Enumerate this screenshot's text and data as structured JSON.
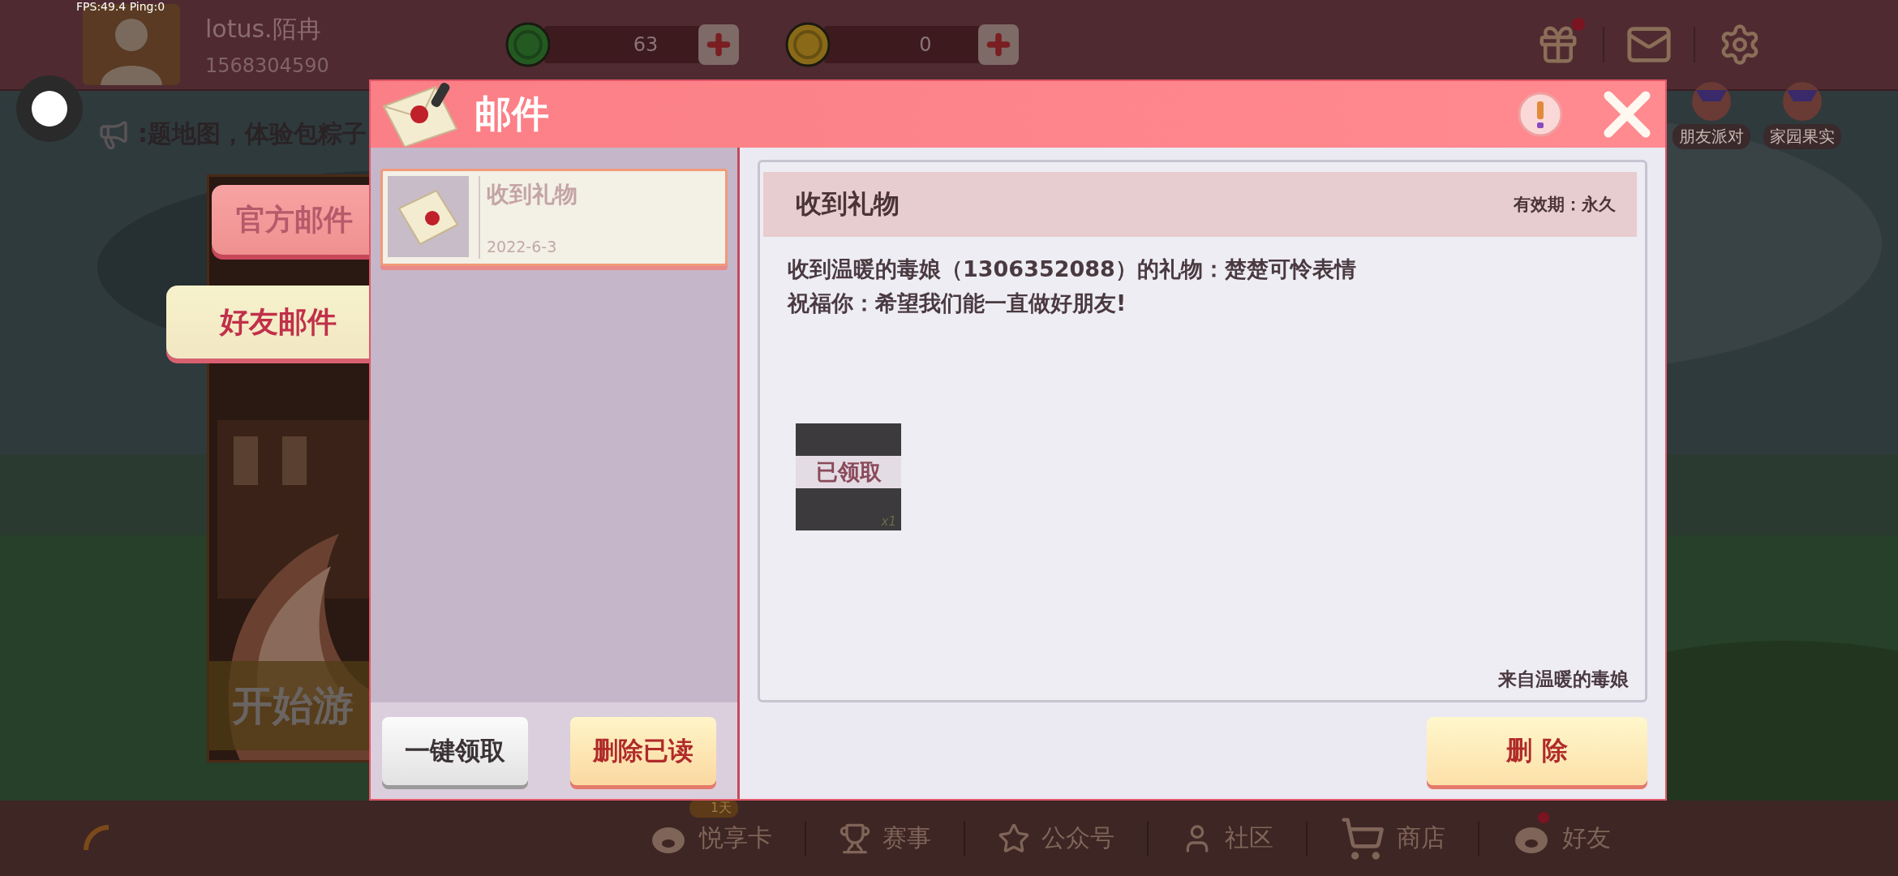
{
  "fps_overlay": "FPS:49.4  Ping:0",
  "profile": {
    "name": "lotus.陌冉",
    "id": "1568304590"
  },
  "currencies": [
    {
      "kind": "green",
      "amount": "63"
    },
    {
      "kind": "gold",
      "amount": "0"
    }
  ],
  "top_icons": [
    {
      "kind": "gift",
      "badge": true
    },
    {
      "kind": "mail",
      "badge": false
    },
    {
      "kind": "settings",
      "badge": false
    }
  ],
  "marquee": ":题地图，体验包粽子",
  "event_buttons": [
    {
      "label": "朋友派对"
    },
    {
      "label": "家园果实"
    }
  ],
  "start_card": {
    "label": "开始游"
  },
  "mail_dialog": {
    "title": "邮件",
    "folders": [
      {
        "label": "官方邮件",
        "selected": false
      },
      {
        "label": "好友邮件",
        "selected": true
      }
    ],
    "messages": [
      {
        "subject": "收到礼物",
        "date": "2022-6-3",
        "selected": true
      }
    ],
    "list_buttons": [
      "一键领取",
      "删除已读"
    ],
    "detail": {
      "subject": "收到礼物",
      "validity": "有效期：永久",
      "body": [
        "收到温暖的毒娘（1306352088）的礼物：楚楚可怜表情",
        "祝福你：希望我们能一直做好朋友!"
      ],
      "attachments": [
        {
          "status": "已领取",
          "count": "x1"
        }
      ],
      "sender": "来自温暖的毒娘",
      "delete_button": "删 除"
    }
  },
  "bottom_nav": [
    {
      "label": "悦享卡",
      "badge": "1天",
      "dot": false
    },
    {
      "label": "赛事",
      "dot": false
    },
    {
      "label": "公众号",
      "dot": false
    },
    {
      "label": "社区",
      "dot": false
    },
    {
      "label": "商店",
      "dot": false
    },
    {
      "label": "好友",
      "dot": true
    }
  ]
}
